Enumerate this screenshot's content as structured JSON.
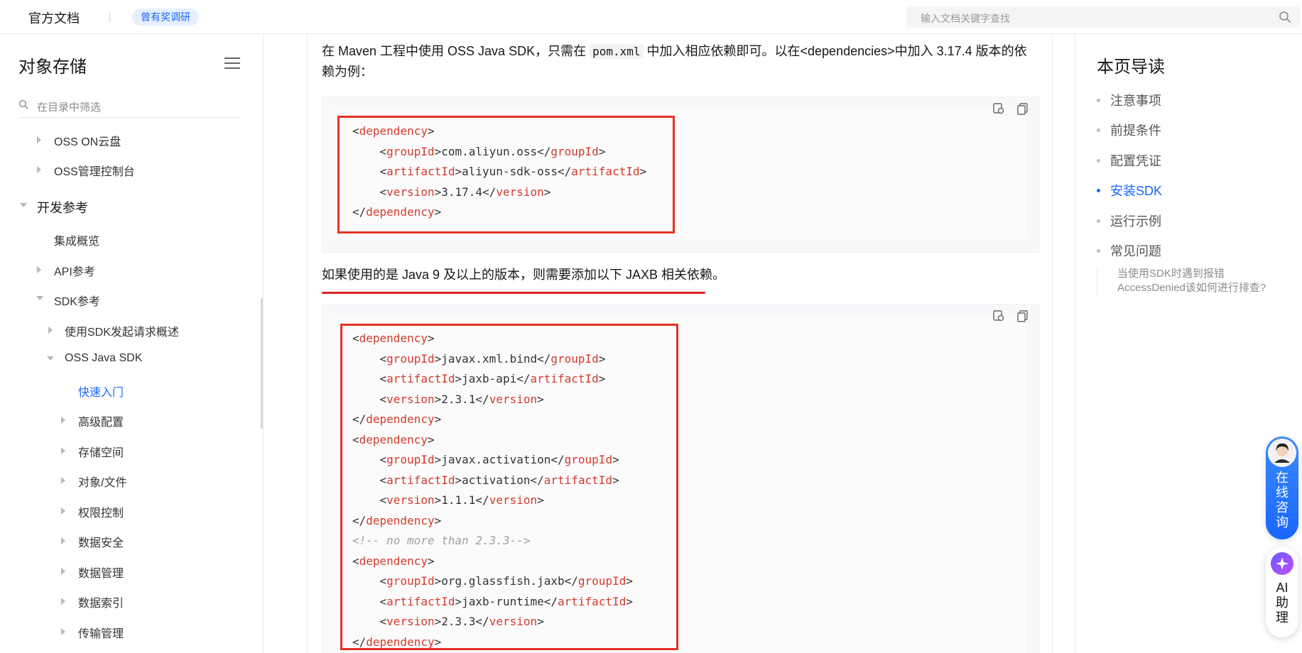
{
  "header": {
    "brand": "官方文档",
    "survey_badge": "曾有奖调研",
    "search_placeholder": "输入文档关键字查找"
  },
  "sidebar": {
    "title": "对象存储",
    "filter_placeholder": "在目录中筛选",
    "items": [
      {
        "label": "OSS ON云盘"
      },
      {
        "label": "OSS管理控制台"
      },
      {
        "label": "开发参考"
      },
      {
        "label": "集成概览"
      },
      {
        "label": "API参考"
      },
      {
        "label": "SDK参考"
      },
      {
        "label": "使用SDK发起请求概述"
      },
      {
        "label": "OSS Java SDK"
      },
      {
        "label": "快速入门"
      },
      {
        "label": "高级配置"
      },
      {
        "label": "存储空间"
      },
      {
        "label": "对象/文件"
      },
      {
        "label": "权限控制"
      },
      {
        "label": "数据安全"
      },
      {
        "label": "数据管理"
      },
      {
        "label": "数据索引"
      },
      {
        "label": "传输管理"
      }
    ]
  },
  "content": {
    "intro_1": "在 Maven 工程中使用 OSS Java SDK，只需在 ",
    "intro_code": "pom.xml",
    "intro_2": " 中加入相应依赖即可。以在<dependencies>中加入 3.17.4 版本的依",
    "intro_3": "赖为例：",
    "jaxb_note": "如果使用的是 Java 9 及以上的版本，则需要添加以下 JAXB 相关依赖。",
    "block1": {
      "lines": [
        {
          "indent": 0,
          "open": "dependency",
          "text": "",
          "close": ""
        },
        {
          "indent": 1,
          "open": "groupId",
          "text": "com.aliyun.oss",
          "close": "groupId"
        },
        {
          "indent": 1,
          "open": "artifactId",
          "text": "aliyun-sdk-oss",
          "close": "artifactId"
        },
        {
          "indent": 1,
          "open": "version",
          "text": "3.17.4",
          "close": "version"
        },
        {
          "indent": 0,
          "open": "",
          "text": "",
          "close": "dependency"
        }
      ]
    },
    "block2": {
      "lines": [
        {
          "indent": 0,
          "open": "dependency",
          "text": "",
          "close": ""
        },
        {
          "indent": 1,
          "open": "groupId",
          "text": "javax.xml.bind",
          "close": "groupId"
        },
        {
          "indent": 1,
          "open": "artifactId",
          "text": "jaxb-api",
          "close": "artifactId"
        },
        {
          "indent": 1,
          "open": "version",
          "text": "2.3.1",
          "close": "version"
        },
        {
          "indent": 0,
          "open": "",
          "text": "",
          "close": "dependency"
        },
        {
          "indent": 0,
          "open": "dependency",
          "text": "",
          "close": ""
        },
        {
          "indent": 1,
          "open": "groupId",
          "text": "javax.activation",
          "close": "groupId"
        },
        {
          "indent": 1,
          "open": "artifactId",
          "text": "activation",
          "close": "artifactId"
        },
        {
          "indent": 1,
          "open": "version",
          "text": "1.1.1",
          "close": "version"
        },
        {
          "indent": 0,
          "open": "",
          "text": "",
          "close": "dependency"
        },
        {
          "indent": 0,
          "comment": "<!-- no more than 2.3.3-->"
        },
        {
          "indent": 0,
          "open": "dependency",
          "text": "",
          "close": ""
        },
        {
          "indent": 1,
          "open": "groupId",
          "text": "org.glassfish.jaxb",
          "close": "groupId"
        },
        {
          "indent": 1,
          "open": "artifactId",
          "text": "jaxb-runtime",
          "close": "artifactId"
        },
        {
          "indent": 1,
          "open": "version",
          "text": "2.3.3",
          "close": "version"
        },
        {
          "indent": 0,
          "open": "",
          "text": "",
          "close": "dependency"
        }
      ]
    }
  },
  "toc": {
    "title": "本页导读",
    "items": [
      {
        "label": "注意事项"
      },
      {
        "label": "前提条件"
      },
      {
        "label": "配置凭证"
      },
      {
        "label": "安装SDK"
      },
      {
        "label": "运行示例"
      },
      {
        "label": "常见问题"
      }
    ],
    "sub_item": "当使用SDK时遇到报错AccessDenied该如何进行排查?"
  },
  "widgets": {
    "consult_label": "在线咨询",
    "ai_label": "AI助理"
  },
  "colors": {
    "accent": "#1a66ff",
    "tag": "#d43a2a",
    "highlight_box": "#e53222"
  }
}
